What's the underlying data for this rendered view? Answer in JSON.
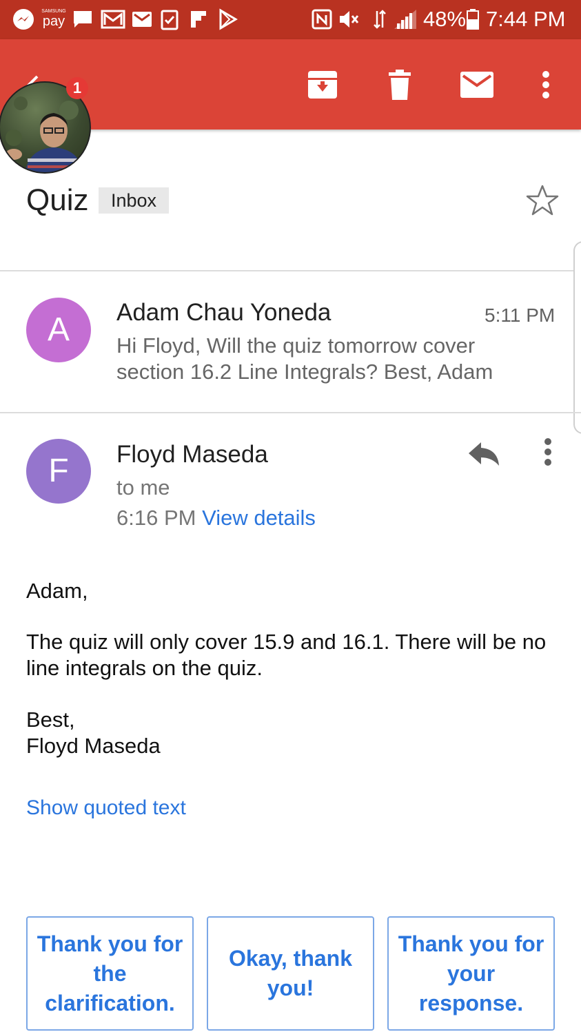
{
  "status_bar": {
    "pay_small_label": "SAMSUNG",
    "pay_label": "pay",
    "battery": "48%",
    "time": "7:44 PM",
    "background_color": "#b93221"
  },
  "app_bar": {
    "background_color": "#db4437",
    "badge_count": "1",
    "icons": [
      "back-arrow-icon",
      "archive-icon",
      "trash-icon",
      "mail-icon",
      "more-vert-icon"
    ]
  },
  "thread": {
    "subject": "Quiz",
    "label": "Inbox"
  },
  "messages": [
    {
      "avatar_letter": "A",
      "avatar_color": "#c46ed3",
      "sender": "Adam Chau Yoneda",
      "time": "5:11 PM",
      "snippet": "Hi Floyd, Will the quiz tomorrow cover section 16.2 Line Integrals? Best, Adam"
    },
    {
      "avatar_letter": "F",
      "avatar_color": "#9575cd",
      "sender": "Floyd Maseda",
      "recipient": "to me",
      "time": "6:16 PM",
      "details_link": "View details",
      "body": {
        "greeting": "Adam,",
        "paragraph": "The quiz will only cover 15.9 and 16.1. There will be no line integrals on the quiz.",
        "closing": "Best,",
        "signature": "Floyd Maseda"
      },
      "show_quoted": "Show quoted text"
    }
  ],
  "smart_replies": [
    "Thank you for the clarification.",
    "Okay, thank you!",
    "Thank you for your response."
  ],
  "accent_color": "#2a75dd"
}
